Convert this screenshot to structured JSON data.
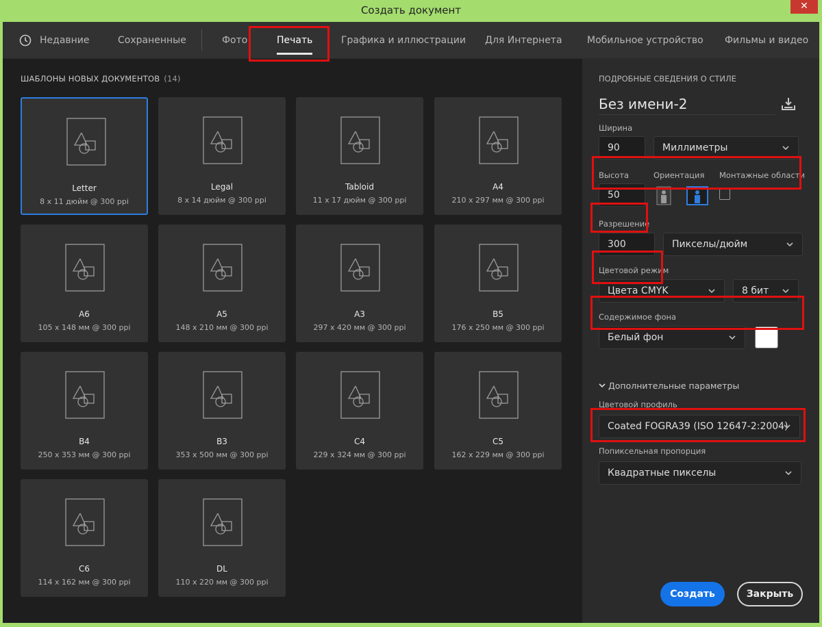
{
  "window": {
    "title": "Создать документ",
    "close": "✕"
  },
  "tabs": [
    {
      "label": "Недавние"
    },
    {
      "label": "Сохраненные"
    },
    {
      "label": "Фото"
    },
    {
      "label": "Печать"
    },
    {
      "label": "Графика и иллюстрации"
    },
    {
      "label": "Для Интернета"
    },
    {
      "label": "Мобильное устройство"
    },
    {
      "label": "Фильмы и видео"
    }
  ],
  "templates": {
    "title": "ШАБЛОНЫ НОВЫХ ДОКУМЕНТОВ",
    "count": "(14)",
    "items": [
      {
        "name": "Letter",
        "meta": "8 x 11 дюйм @ 300 ppi"
      },
      {
        "name": "Legal",
        "meta": "8 x 14 дюйм @ 300 ppi"
      },
      {
        "name": "Tabloid",
        "meta": "11 x 17 дюйм @ 300 ppi"
      },
      {
        "name": "A4",
        "meta": "210 x 297 мм @ 300 ppi"
      },
      {
        "name": "A6",
        "meta": "105 x 148 мм @ 300 ppi"
      },
      {
        "name": "A5",
        "meta": "148 x 210 мм @ 300 ppi"
      },
      {
        "name": "A3",
        "meta": "297 x 420 мм @ 300 ppi"
      },
      {
        "name": "B5",
        "meta": "176 x 250 мм @ 300 ppi"
      },
      {
        "name": "B4",
        "meta": "250 x 353 мм @ 300 ppi"
      },
      {
        "name": "B3",
        "meta": "353 x 500 мм @ 300 ppi"
      },
      {
        "name": "C4",
        "meta": "229 x 324 мм @ 300 ppi"
      },
      {
        "name": "C5",
        "meta": "162 x 229 мм @ 300 ppi"
      },
      {
        "name": "C6",
        "meta": "114 x 162 мм @ 300 ppi"
      },
      {
        "name": "DL",
        "meta": "110 x 220 мм @ 300 ppi"
      }
    ]
  },
  "details": {
    "title": "ПОДРОБНЫЕ СВЕДЕНИЯ О СТИЛЕ",
    "doc_name": "Без имени-2",
    "width_label": "Ширина",
    "width_value": "90",
    "units": "Миллиметры",
    "height_label": "Высота",
    "height_value": "50",
    "orientation_label": "Ориентация",
    "artboards_label": "Монтажные области",
    "resolution_label": "Разрешение",
    "resolution_value": "300",
    "resolution_units": "Пикселы/дюйм",
    "color_mode_label": "Цветовой режим",
    "color_mode": "Цвета CMYK",
    "bit_depth": "8 бит",
    "background_label": "Содержимое фона",
    "background": "Белый фон",
    "background_color": "#ffffff",
    "advanced": "Дополнительные параметры",
    "profile_label": "Цветовой профиль",
    "profile": "Coated FOGRA39 (ISO 12647-2:2004)",
    "pixel_aspect_label": "Попиксельная пропорция",
    "pixel_aspect": "Квадратные пикселы"
  },
  "buttons": {
    "create": "Создать",
    "close": "Закрыть"
  },
  "colors": {
    "accent": "#1473e6",
    "highlight": "#e01010",
    "selected_border": "#2e7ee0"
  }
}
